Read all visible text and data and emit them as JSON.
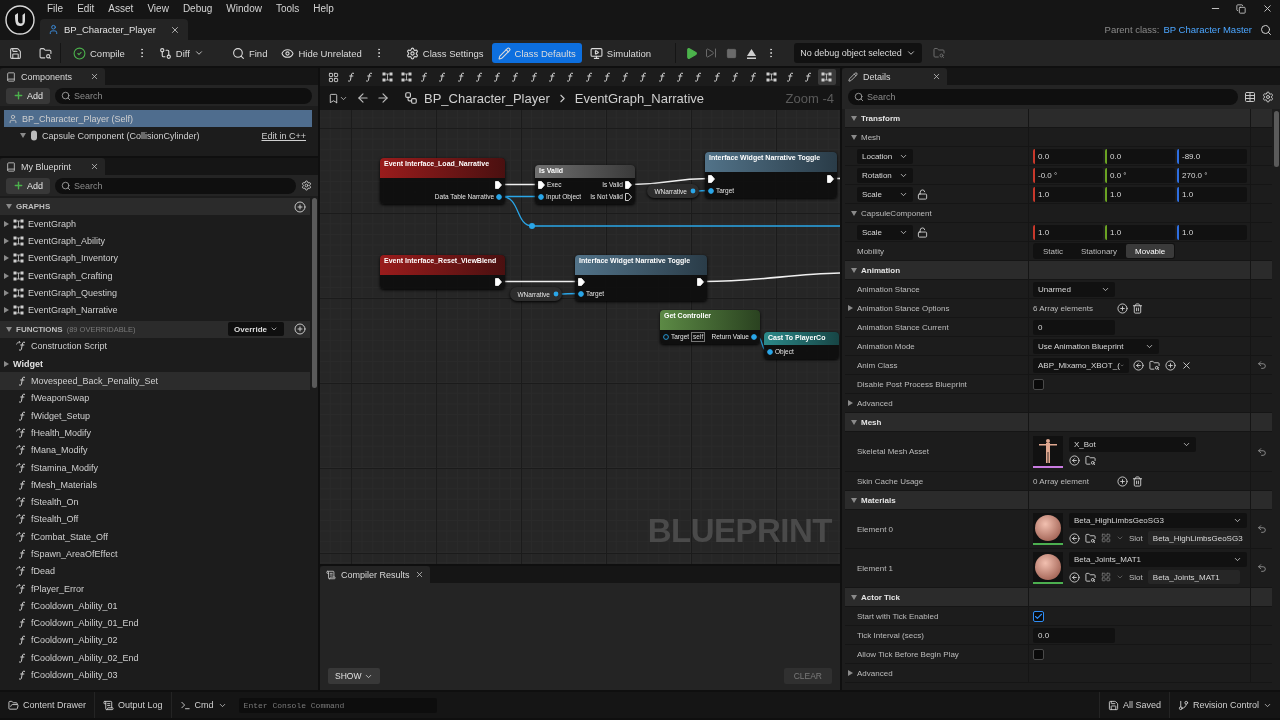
{
  "menu": [
    "File",
    "Edit",
    "Asset",
    "View",
    "Debug",
    "Window",
    "Tools",
    "Help"
  ],
  "document_tab": {
    "title": "BP_Character_Player"
  },
  "parent_class": {
    "label": "Parent class:",
    "value": "BP Character Master"
  },
  "toolbar": {
    "buttons": [
      {
        "kind": "compile",
        "label": "Compile",
        "selected": false
      },
      {
        "kind": "diff",
        "label": "Diff",
        "selected": false
      },
      {
        "kind": "find",
        "label": "Find",
        "selected": false
      },
      {
        "kind": "hide",
        "label": "Hide Unrelated",
        "selected": false
      },
      {
        "kind": "settings",
        "label": "Class Settings",
        "selected": false
      },
      {
        "kind": "defaults",
        "label": "Class Defaults",
        "selected": true
      },
      {
        "kind": "simulation",
        "label": "Simulation",
        "selected": false
      }
    ],
    "debug_object": "No debug object selected"
  },
  "components": {
    "title": "Components",
    "add": "Add",
    "search_placeholder": "Search",
    "items": [
      {
        "kind": "self",
        "label": "BP_Character_Player (Self)",
        "selected": true
      },
      {
        "kind": "capsule",
        "label": "Capsule Component (CollisionCylinder)",
        "selected": false,
        "link": "Edit in C++"
      }
    ]
  },
  "my_blueprint": {
    "title": "My Blueprint",
    "add": "Add",
    "search_placeholder": "Search",
    "graphs_title": "GRAPHS",
    "graphs": [
      {
        "label": "EventGraph",
        "expanded": false
      },
      {
        "label": "EventGraph_Ability",
        "expanded": false
      },
      {
        "label": "EventGraph_Inventory",
        "expanded": false
      },
      {
        "label": "EventGraph_Crafting",
        "expanded": false
      },
      {
        "label": "EventGraph_Questing",
        "expanded": false
      },
      {
        "label": "EventGraph_Narrative",
        "expanded": false
      }
    ],
    "functions_title": "FUNCTIONS",
    "functions_note": "(89 OVERRIDABLE)",
    "override": "Override",
    "functions": [
      {
        "kind": "override",
        "label": "Construction Script",
        "hovered": false
      },
      {
        "kind": "category",
        "label": "Widget",
        "hovered": false
      },
      {
        "kind": "function",
        "label": "Movespeed_Back_Penality_Set",
        "hovered": true
      },
      {
        "kind": "function",
        "label": "fWeaponSwap",
        "hovered": false
      },
      {
        "kind": "function",
        "label": "fWidget_Setup",
        "hovered": false
      },
      {
        "kind": "override",
        "label": "fHealth_Modify",
        "hovered": false
      },
      {
        "kind": "override",
        "label": "fMana_Modify",
        "hovered": false
      },
      {
        "kind": "override",
        "label": "fStamina_Modify",
        "hovered": false
      },
      {
        "kind": "function",
        "label": "fMesh_Materials",
        "hovered": false
      },
      {
        "kind": "override",
        "label": "fStealth_On",
        "hovered": false
      },
      {
        "kind": "override",
        "label": "fStealth_Off",
        "hovered": false
      },
      {
        "kind": "override",
        "label": "fCombat_State_Off",
        "hovered": false
      },
      {
        "kind": "function",
        "label": "fSpawn_AreaOfEffect",
        "hovered": false
      },
      {
        "kind": "override",
        "label": "fDead",
        "hovered": false
      },
      {
        "kind": "override",
        "label": "fPlayer_Error",
        "hovered": false
      },
      {
        "kind": "function",
        "label": "fCooldown_Ability_01",
        "hovered": false
      },
      {
        "kind": "function",
        "label": "fCooldown_Ability_01_End",
        "hovered": false
      },
      {
        "kind": "function",
        "label": "fCooldown_Ability_02",
        "hovered": false
      },
      {
        "kind": "function",
        "label": "fCooldown_Ability_02_End",
        "hovered": false
      },
      {
        "kind": "function",
        "label": "fCooldown_Ability_03",
        "hovered": false
      }
    ]
  },
  "graph_editor": {
    "strip": [
      {
        "kind": "grid",
        "selected": false
      },
      {
        "kind": "function",
        "selected": false
      },
      {
        "kind": "function",
        "selected": false
      },
      {
        "kind": "graph",
        "selected": false
      },
      {
        "kind": "graph",
        "selected": false
      },
      {
        "kind": "function",
        "selected": false
      },
      {
        "kind": "function",
        "selected": false
      },
      {
        "kind": "function",
        "selected": false
      },
      {
        "kind": "function",
        "selected": false
      },
      {
        "kind": "function",
        "selected": false
      },
      {
        "kind": "function",
        "selected": false
      },
      {
        "kind": "function",
        "selected": false
      },
      {
        "kind": "function",
        "selected": false
      },
      {
        "kind": "function",
        "selected": false
      },
      {
        "kind": "function",
        "selected": false
      },
      {
        "kind": "function",
        "selected": false
      },
      {
        "kind": "function",
        "selected": false
      },
      {
        "kind": "function",
        "selected": false
      },
      {
        "kind": "function",
        "selected": false
      },
      {
        "kind": "function",
        "selected": false
      },
      {
        "kind": "function",
        "selected": false
      },
      {
        "kind": "function",
        "selected": false
      },
      {
        "kind": "function",
        "selected": false
      },
      {
        "kind": "function",
        "selected": false
      },
      {
        "kind": "graph",
        "selected": false
      },
      {
        "kind": "function",
        "selected": false
      },
      {
        "kind": "function",
        "selected": false
      },
      {
        "kind": "graph",
        "selected": true
      }
    ],
    "breadcrumb": [
      "BP_Character_Player",
      "EventGraph_Narrative"
    ],
    "zoom": "Zoom -4",
    "watermark": "BLUEPRINT",
    "nodes": [
      {
        "kind": "event",
        "title": "Event Interface_Load_Narrative",
        "rows": [
          {
            "out": {
              "kind": "exec",
              "connected": true
            }
          },
          {
            "out": {
              "kind": "object",
              "label": "Data Table Narrative",
              "connected": true
            }
          }
        ]
      },
      {
        "kind": "macro",
        "title": "Is Valid",
        "rows": [
          {
            "in": {
              "kind": "exec",
              "label": "Exec",
              "connected": true
            },
            "out": {
              "kind": "exec",
              "label": "Is Valid",
              "connected": true
            }
          },
          {
            "in": {
              "kind": "object",
              "label": "Input Object",
              "connected": true
            },
            "out": {
              "kind": "exec",
              "label": "Is Not Valid",
              "connected": false
            }
          }
        ]
      },
      {
        "kind": "variable",
        "title": "WNarrative"
      },
      {
        "kind": "interface",
        "title": "Interface Widget Narrative Toggle",
        "rows": [
          {
            "in": {
              "kind": "exec",
              "connected": true
            },
            "out": {
              "kind": "exec",
              "connected": true
            }
          },
          {
            "in": {
              "kind": "object",
              "label": "Target",
              "connected": true
            }
          }
        ]
      },
      {
        "kind": "event",
        "title": "Event Interface_Reset_ViewBlend",
        "rows": [
          {
            "out": {
              "kind": "exec",
              "connected": true
            }
          }
        ]
      },
      {
        "kind": "variable",
        "title": "WNarrative"
      },
      {
        "kind": "interface",
        "title": "Interface Widget Narrative Toggle",
        "rows": [
          {
            "in": {
              "kind": "exec",
              "connected": true
            },
            "out": {
              "kind": "exec",
              "connected": true
            }
          },
          {
            "in": {
              "kind": "object",
              "label": "Target",
              "connected": true
            }
          }
        ]
      },
      {
        "kind": "pure",
        "title": "Get Controller",
        "rows": [
          {
            "in": {
              "kind": "object",
              "label": "Target",
              "connected": false,
              "default": "self"
            },
            "out": {
              "kind": "object",
              "label": "Return Value",
              "connected": true
            }
          }
        ]
      },
      {
        "kind": "cast",
        "title": "Cast To PlayerCo",
        "rows": [
          {
            "in": {
              "kind": "object",
              "label": "Object",
              "connected": true
            }
          }
        ]
      }
    ]
  },
  "compiler": {
    "title": "Compiler Results",
    "show": "SHOW",
    "clear": "CLEAR"
  },
  "details": {
    "title": "Details",
    "search_placeholder": "Search",
    "rows": [
      {
        "kind": "section",
        "label": "Transform"
      },
      {
        "kind": "group",
        "label": "Mesh"
      },
      {
        "kind": "vector",
        "label": "Location",
        "values": [
          "0.0",
          "0.0",
          "-89.0"
        ]
      },
      {
        "kind": "vector",
        "label": "Rotation",
        "values": [
          "-0.0 °",
          "0.0 °",
          "270.0 °"
        ]
      },
      {
        "kind": "vector",
        "label": "Scale",
        "values": [
          "1.0",
          "1.0",
          "1.0"
        ],
        "lock": true
      },
      {
        "kind": "group",
        "label": "CapsuleComponent"
      },
      {
        "kind": "vector",
        "label": "Scale",
        "values": [
          "1.0",
          "1.0",
          "1.0"
        ],
        "lock": true
      },
      {
        "kind": "segmented",
        "label": "Mobility",
        "options": [
          {
            "label": "Static",
            "selected": false
          },
          {
            "label": "Stationary",
            "selected": false
          },
          {
            "label": "Movable",
            "selected": true
          }
        ]
      },
      {
        "kind": "section",
        "label": "Animation"
      },
      {
        "kind": "dropdown",
        "label": "Animation Stance",
        "value": "Unarmed"
      },
      {
        "kind": "array",
        "label": "Animation Stance Options",
        "value": "6 Array elements",
        "expandable": true
      },
      {
        "kind": "input",
        "label": "Animation Stance Current",
        "value": "0"
      },
      {
        "kind": "dropdown",
        "label": "Animation Mode",
        "value": "Use Animation Blueprint"
      },
      {
        "kind": "class",
        "label": "Anim Class",
        "value": "ABP_Mixamo_XBOT_(",
        "reset": true
      },
      {
        "kind": "checkbox",
        "label": "Disable Post Process Blueprint",
        "checked": false
      },
      {
        "kind": "advanced",
        "label": "Advanced"
      },
      {
        "kind": "section",
        "label": "Mesh"
      },
      {
        "kind": "asset",
        "label": "Skeletal Mesh Asset",
        "value": "X_Bot",
        "reset": true
      },
      {
        "kind": "array",
        "label": "Skin Cache Usage",
        "value": "0 Array element",
        "expandable": false
      },
      {
        "kind": "section",
        "label": "Materials"
      },
      {
        "kind": "material",
        "label": "Element 0",
        "value": "Beta_HighLimbsGeoSG3",
        "slot_label": "Slot",
        "slot": "Beta_HighLimbsGeoSG3",
        "reset": true
      },
      {
        "kind": "material",
        "label": "Element 1",
        "value": "Beta_Joints_MAT1",
        "slot_label": "Slot",
        "slot": "Beta_Joints_MAT1",
        "reset": true
      },
      {
        "kind": "section",
        "label": "Actor Tick"
      },
      {
        "kind": "checkbox",
        "label": "Start with Tick Enabled",
        "checked": true
      },
      {
        "kind": "input",
        "label": "Tick Interval (secs)",
        "value": "0.0"
      },
      {
        "kind": "checkbox",
        "label": "Allow Tick Before Begin Play",
        "checked": false
      },
      {
        "kind": "advanced",
        "label": "Advanced"
      }
    ]
  },
  "bottom_bar": {
    "content_drawer": "Content Drawer",
    "output_log": "Output Log",
    "cmd": "Cmd",
    "console_placeholder": "Enter Console Command",
    "saved": "All Saved",
    "revision": "Revision Control"
  }
}
